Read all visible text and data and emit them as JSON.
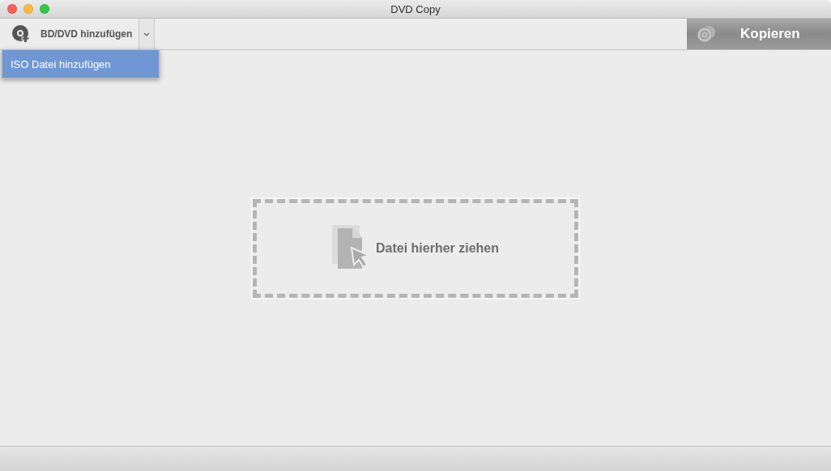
{
  "window": {
    "title": "DVD Copy"
  },
  "toolbar": {
    "add_button": {
      "label": "BD/DVD hinzufügen"
    },
    "copy_button": {
      "label": "Kopieren"
    }
  },
  "menu": {
    "items": [
      {
        "label": "ISO Datei hinzufügen",
        "selected": true
      }
    ]
  },
  "drop_zone": {
    "text": "Datei hierher ziehen"
  }
}
